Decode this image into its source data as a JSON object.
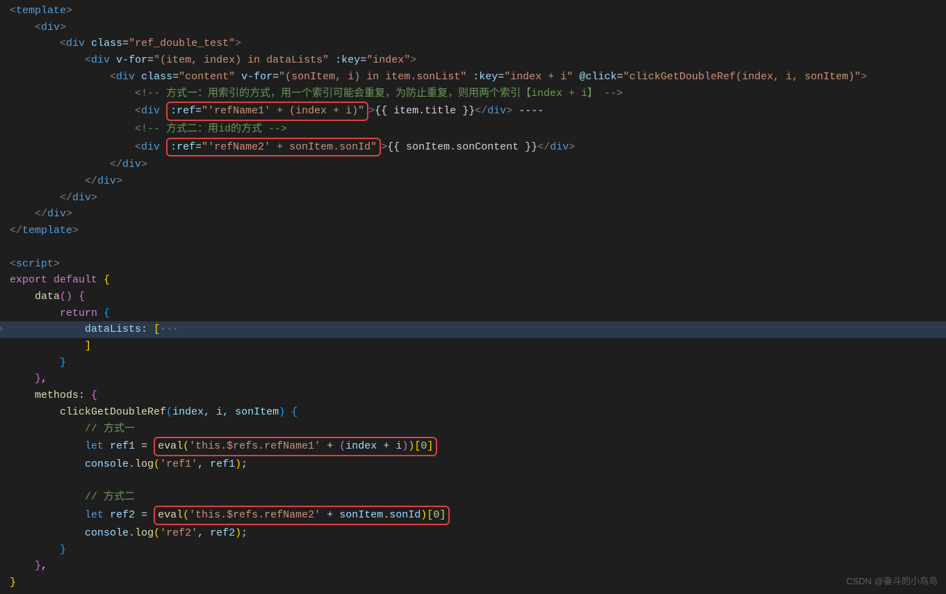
{
  "code": {
    "l1": {
      "tag_open": "<",
      "tag": "template",
      "tag_close": ">"
    },
    "l2": {
      "tag_open": "<",
      "tag": "div",
      "tag_close": ">"
    },
    "l3": {
      "tag_open": "<",
      "tag": "div",
      "sp": " ",
      "attr": "class",
      "eq": "=",
      "val": "\"ref_double_test\"",
      "tag_close": ">"
    },
    "l4": {
      "tag_open": "<",
      "tag": "div",
      "sp": " ",
      "attr": "v-for",
      "eq": "=",
      "val": "\"(item, index) in dataLists\"",
      "sp2": " ",
      "attr2": ":key",
      "eq2": "=",
      "val2": "\"index\"",
      "tag_close": ">"
    },
    "l5": {
      "tag_open": "<",
      "tag": "div",
      "sp": " ",
      "attr": "class",
      "eq": "=",
      "val": "\"content\"",
      "sp2": " ",
      "attr2": "v-for",
      "eq2": "=",
      "val2": "\"(sonItem, i) in item.sonList\"",
      "sp3": " ",
      "attr3": ":key",
      "eq3": "=",
      "val3": "\"index + i\"",
      "sp4": " ",
      "attr4": "@click",
      "eq4": "=",
      "val4": "\"clickGetDoubleRef(index, i, sonItem)\"",
      "tag_close": ">"
    },
    "l6": {
      "comment": "<!-- 方式一：用索引的方式，用一个索引可能会重复，为防止重复，则用两个索引【index + i】 -->"
    },
    "l7": {
      "tag_open": "<",
      "tag": "div",
      "sp": " ",
      "boxed": ":ref=\"'refName1' + (index + i)\"",
      "tag_close": ">",
      "mustache": "{{ item.title }}",
      "close_open": "</",
      "close_tag": "div",
      "close_end": ">",
      "trail": " ----"
    },
    "l8": {
      "comment": "<!-- 方式二：用id的方式 -->"
    },
    "l9": {
      "tag_open": "<",
      "tag": "div",
      "sp": " ",
      "boxed": ":ref=\"'refName2' + sonItem.sonId\"",
      "tag_close": ">",
      "mustache": "{{ sonItem.sonContent }}",
      "close_open": "</",
      "close_tag": "div",
      "close_end": ">"
    },
    "l10": {
      "close": "</",
      "tag": "div",
      "end": ">"
    },
    "l11": {
      "close": "</",
      "tag": "div",
      "end": ">"
    },
    "l12": {
      "close": "</",
      "tag": "div",
      "end": ">"
    },
    "l13": {
      "close": "</",
      "tag": "div",
      "end": ">"
    },
    "l14": {
      "close": "</",
      "tag": "template",
      "end": ">"
    },
    "l16": {
      "tag_open": "<",
      "tag": "script",
      "tag_close": ">"
    },
    "l17": {
      "kw1": "export",
      "sp": " ",
      "kw2": "default",
      "sp2": " ",
      "brace": "{"
    },
    "l18": {
      "fn": "data",
      "paren": "()",
      "sp": " ",
      "brace": "{"
    },
    "l19": {
      "kw": "return",
      "sp": " ",
      "brace": "{"
    },
    "l20": {
      "prop": "dataLists",
      "colon": ": ",
      "bracket": "[",
      "dots": "···"
    },
    "l21": {
      "bracket": "]"
    },
    "l22": {
      "brace": "}"
    },
    "l23": {
      "brace": "}",
      "comma": ","
    },
    "l24": {
      "prop": "methods",
      "colon": ": ",
      "brace": "{"
    },
    "l25": {
      "fn": "clickGetDoubleRef",
      "paren_open": "(",
      "params": "index, i, sonItem",
      "paren_close": ")",
      "sp": " ",
      "brace": "{"
    },
    "l26": {
      "comment": "// 方式一"
    },
    "l27": {
      "kw": "let",
      "sp": " ",
      "var": "ref1",
      "sp2": " ",
      "op": "=",
      "sp3": " ",
      "box_eval": "eval",
      "box_po": "(",
      "box_str": "'this.$refs.refName1'",
      "box_sp": " ",
      "box_plus": "+",
      "box_sp2": " ",
      "box_po2": "(",
      "box_v1": "index",
      "box_sp3": " ",
      "box_plus2": "+",
      "box_sp4": " ",
      "box_v2": "i",
      "box_pc2": ")",
      "box_pc": ")",
      "box_bo": "[",
      "box_num": "0",
      "box_bc": "]"
    },
    "l28": {
      "obj": "console",
      "dot": ".",
      "fn": "log",
      "po": "(",
      "str": "'ref1'",
      "comma": ", ",
      "var": "ref1",
      "pc": ")",
      "semi": ";"
    },
    "l30": {
      "comment": "// 方式二"
    },
    "l31": {
      "kw": "let",
      "sp": " ",
      "var": "ref2",
      "sp2": " ",
      "op": "=",
      "sp3": " ",
      "box_eval": "eval",
      "box_po": "(",
      "box_str": "'this.$refs.refName2'",
      "box_sp": " ",
      "box_plus": "+",
      "box_sp2": " ",
      "box_obj": "sonItem",
      "box_dot": ".",
      "box_prop": "sonId",
      "box_pc": ")",
      "box_bo": "[",
      "box_num": "0",
      "box_bc": "]"
    },
    "l32": {
      "obj": "console",
      "dot": ".",
      "fn": "log",
      "po": "(",
      "str": "'ref2'",
      "comma": ", ",
      "var": "ref2",
      "pc": ")",
      "semi": ";"
    },
    "l33": {
      "brace": "}"
    },
    "l34": {
      "brace": "}",
      "comma": ","
    },
    "l35": {
      "brace": "}"
    }
  },
  "watermark": "CSDN @奋斗的小鸟鸟"
}
